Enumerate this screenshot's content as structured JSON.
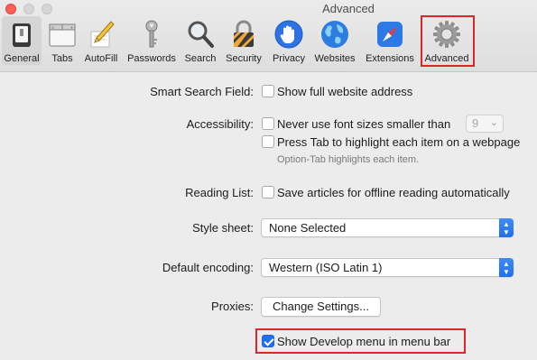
{
  "window": {
    "title": "Advanced"
  },
  "toolbar": {
    "items": [
      {
        "label": "General",
        "icon": "general-icon"
      },
      {
        "label": "Tabs",
        "icon": "tabs-icon"
      },
      {
        "label": "AutoFill",
        "icon": "autofill-pencil-icon"
      },
      {
        "label": "Passwords",
        "icon": "key-icon"
      },
      {
        "label": "Search",
        "icon": "magnifier-icon"
      },
      {
        "label": "Security",
        "icon": "padlock-icon"
      },
      {
        "label": "Privacy",
        "icon": "hand-icon"
      },
      {
        "label": "Websites",
        "icon": "globe-icon"
      },
      {
        "label": "Extensions",
        "icon": "compass-icon"
      },
      {
        "label": "Advanced",
        "icon": "gear-icon"
      }
    ],
    "selected": "General",
    "highlighted": "Advanced"
  },
  "settings": {
    "smart_search": {
      "label": "Smart Search Field:",
      "option": "Show full website address",
      "checked": false
    },
    "accessibility": {
      "label": "Accessibility:",
      "font_option": "Never use font sizes smaller than",
      "font_size": "9",
      "tab_option": "Press Tab to highlight each item on a webpage",
      "tab_hint": "Option-Tab highlights each item."
    },
    "reading_list": {
      "label": "Reading List:",
      "option": "Save articles for offline reading automatically"
    },
    "style_sheet": {
      "label": "Style sheet:",
      "value": "None Selected"
    },
    "encoding": {
      "label": "Default encoding:",
      "value": "Western (ISO Latin 1)"
    },
    "proxies": {
      "label": "Proxies:",
      "button": "Change Settings..."
    },
    "develop_menu": {
      "option": "Show Develop menu in menu bar",
      "checked": true
    }
  },
  "colors": {
    "accent": "#1f6ff0",
    "highlight": "#e0242b",
    "close": "#fe5f57"
  }
}
